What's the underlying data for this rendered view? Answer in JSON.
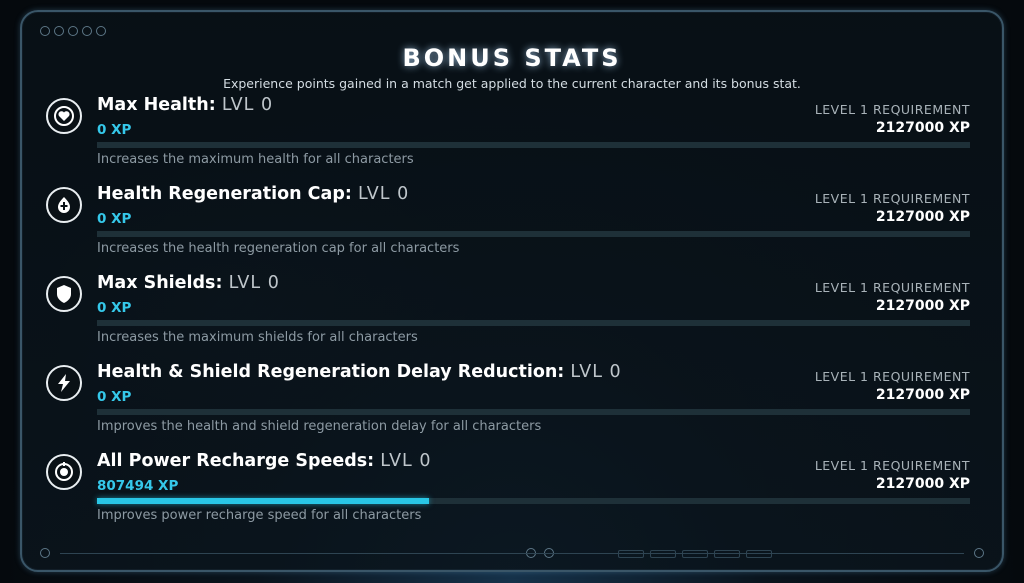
{
  "header": {
    "title": "BONUS STATS",
    "subtitle": "Experience points gained in a match get applied to the current character and its bonus stat."
  },
  "stats": [
    {
      "icon": "heart-shield-icon",
      "name": "Max Health:",
      "level": "LVL 0",
      "xp": "0 XP",
      "progress": 0,
      "requirement_label": "LEVEL 1 REQUIREMENT",
      "requirement_value": "2127000 XP",
      "description": "Increases the maximum health for all characters"
    },
    {
      "icon": "health-regen-icon",
      "name": "Health Regeneration Cap:",
      "level": "LVL 0",
      "xp": "0 XP",
      "progress": 0,
      "requirement_label": "LEVEL 1 REQUIREMENT",
      "requirement_value": "2127000 XP",
      "description": "Increases the health regeneration cap for all characters"
    },
    {
      "icon": "shield-icon",
      "name": "Max Shields:",
      "level": "LVL 0",
      "xp": "0 XP",
      "progress": 0,
      "requirement_label": "LEVEL 1 REQUIREMENT",
      "requirement_value": "2127000 XP",
      "description": "Increases the maximum shields for all characters"
    },
    {
      "icon": "lightning-bolt-icon",
      "name": "Health & Shield Regeneration Delay Reduction:",
      "level": "LVL 0",
      "xp": "0 XP",
      "progress": 0,
      "requirement_label": "LEVEL 1 REQUIREMENT",
      "requirement_value": "2127000 XP",
      "description": "Improves the health and shield regeneration delay for all characters"
    },
    {
      "icon": "power-recharge-icon",
      "name": "All Power Recharge Speeds:",
      "level": "LVL 0",
      "xp": "807494 XP",
      "progress": 0.38,
      "requirement_label": "LEVEL 1 REQUIREMENT",
      "requirement_value": "2127000 XP",
      "description": "Improves power recharge speed for all characters"
    }
  ],
  "colors": {
    "accent": "#29c6e6",
    "xp_text": "#35c8ea",
    "track": "#1e3038",
    "panel_border": "#3a5668"
  }
}
